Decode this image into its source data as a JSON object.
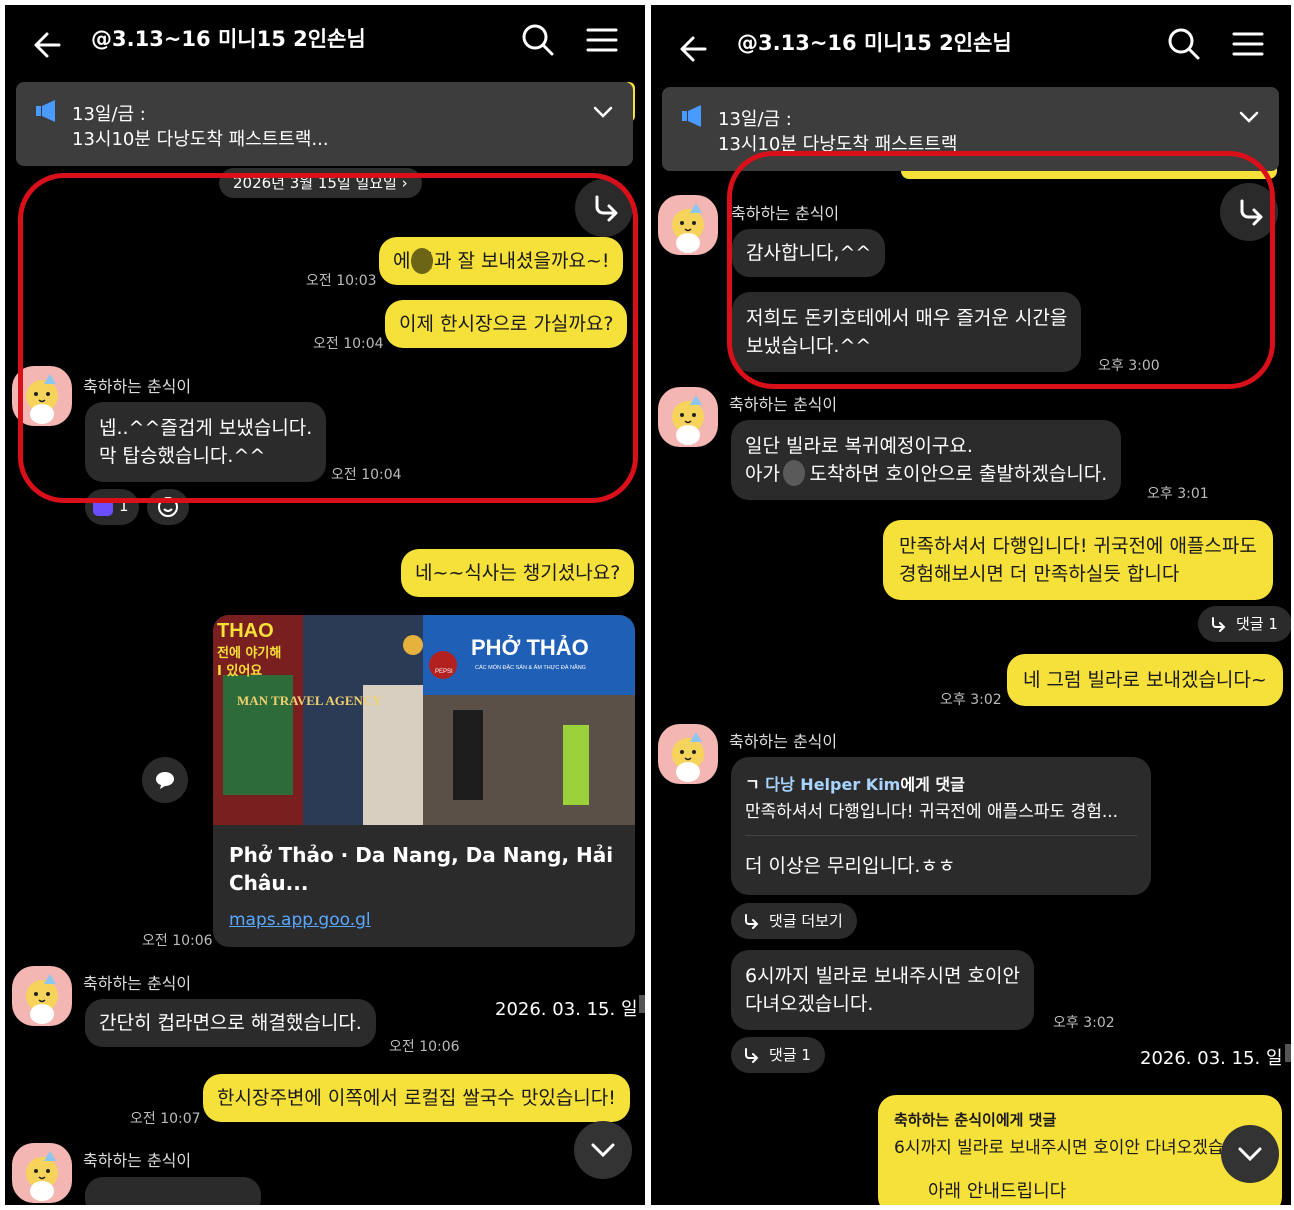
{
  "colors": {
    "background": "#000000",
    "bubble_yellow": "#f6e03a",
    "bubble_gray": "#2b2b2b",
    "highlight_red": "#d9101a",
    "link": "#5aa8ff"
  },
  "left": {
    "header": {
      "title": "@3.13~16 미니15 2인손님"
    },
    "notice": {
      "line1": "13일/금 :",
      "line2": "13시10분 다낭도착 패스트트랙..."
    },
    "date_pill": "2026년 3월 15일 일요일  ›",
    "messages": [
      {
        "text": "에  들과 잘 보내셨을까요~!",
        "time": "오전 10:03"
      },
      {
        "text": "이제 한시장으로 가실까요?",
        "time": "오전 10:04"
      },
      {
        "sender": "축하하는 춘식이",
        "line1": "넵..^^즐겁게 보냈습니다.",
        "line2": "막 탑승했습니다.^^",
        "time": "오전 10:04"
      },
      {
        "text": "네~~식사는 챙기셨나요?"
      },
      {
        "sender": "축하하는 춘식이",
        "text": "간단히 컵라면으로 해결했습니다.",
        "time": "오전 10:06"
      },
      {
        "text": "한시장주변에 이쪽에서 로컬집 쌀국수 맛있습니다!",
        "time": "오전 10:07"
      },
      {
        "sender": "축하하는 춘식이"
      }
    ],
    "reaction_count": "1",
    "link_card": {
      "title_line1": "Phở Thảo · Da Nang, Da Nang, Hải",
      "title_line2": "Châu...",
      "url": "maps.app.goo.gl",
      "time": "오전 10:06",
      "image_sign1": "PHỞ THẢO",
      "image_sign2": "THAO",
      "image_sign3": "MAN TRAVEL AGENCY",
      "image_sign4": "CÁC MÓN ĐẶC SẢN & ẨM THỰC ĐÀ NẴNG",
      "image_sign5": "PEPSI",
      "image_sign6": "전에 야기해",
      "image_sign7": "I 있어요"
    },
    "date_label": "2026. 03. 15. 일"
  },
  "right": {
    "header": {
      "title": "@3.13~16 미니15 2인손님"
    },
    "notice": {
      "line1": "13일/금 :",
      "line2": "13시10분 다낭도착 패스트트랙"
    },
    "messages": [
      {
        "sender": "축하하는 춘식이",
        "text": "감사합니다,^^"
      },
      {
        "line1": "저희도 돈키호테에서 매우 즐거운 시간을",
        "line2": "보냈습니다.^^",
        "time": "오후 3:00"
      },
      {
        "sender": "축하하는 춘식이",
        "line1": "일단 빌라로 복귀예정이구요.",
        "line2": "아가  들 도착하면 호이안으로 출발하겠습니다.",
        "time": "오후 3:01"
      },
      {
        "line1": "만족하셔서 다행입니다! 귀국전에 애플스파도",
        "line2": "경험해보시면 더 만족하실듯 합니다"
      },
      {
        "text": "네 그럼 빌라로 보내겠습니다~",
        "time": "오후 3:02"
      },
      {
        "sender": "축하하는 춘식이"
      },
      {
        "line1": "6시까지 빌라로 보내주시면 호이안",
        "line2": "다녀오겠습니다.",
        "time": "오후 3:02"
      }
    ],
    "chip_reply1": "댓글 1",
    "reply_card": {
      "prefix": "ㄱ ",
      "name": "다낭 Helper Kim",
      "suffix": "에게 댓글",
      "quote": "만족하셔서 다행입니다! 귀국전에 애플스파도 경험...",
      "body": "더 이상은 무리입니다.ㅎㅎ"
    },
    "chip_more": "댓글 더보기",
    "chip_reply2": "댓글 1",
    "date_label": "2026. 03. 15. 일",
    "yellow_reply": {
      "title": "축하하는 춘식이에게 댓글",
      "quote": "6시까지 빌라로 보내주시면 호이안 다녀오겠습",
      "body": "아래 안내드립니다"
    }
  }
}
